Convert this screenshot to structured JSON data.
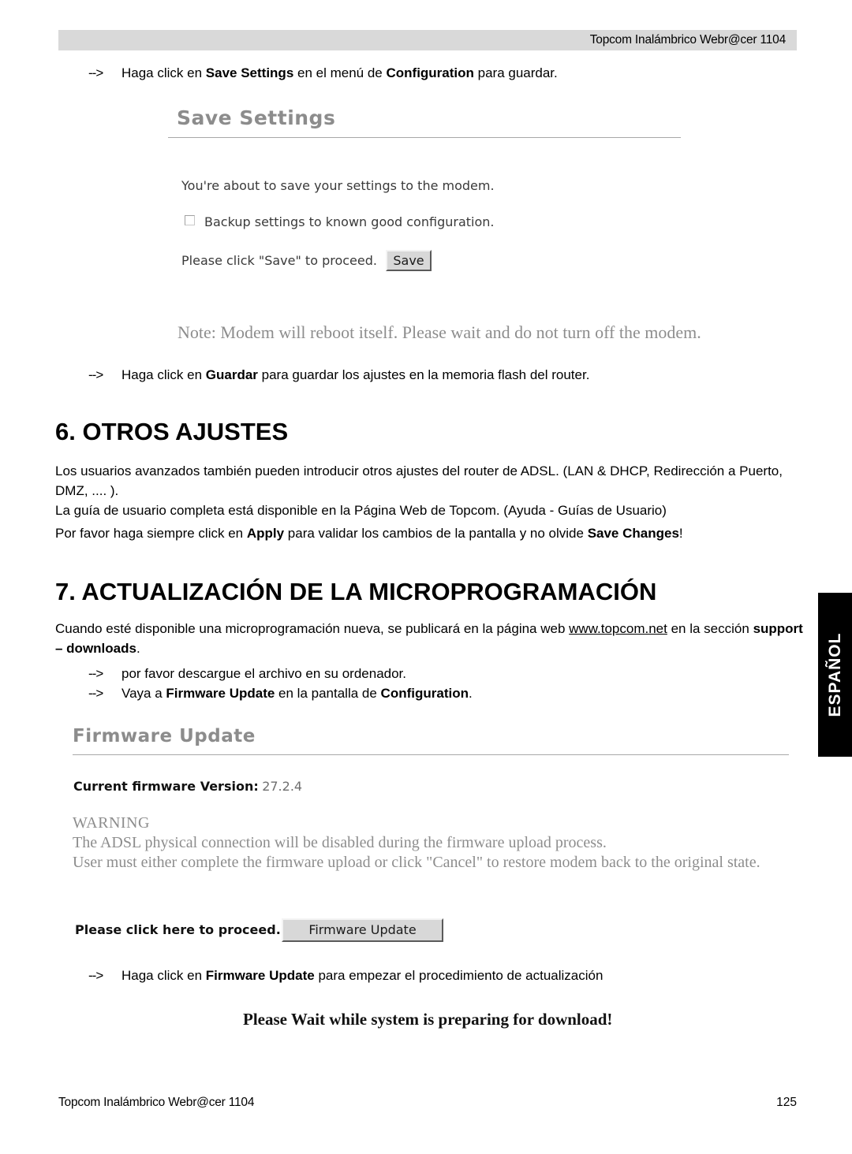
{
  "header": {
    "title": "Topcom Inalámbrico Webr@cer 1104"
  },
  "instructions": {
    "save_settings_intro_prefix": "Haga click en ",
    "save_settings_intro_bold1": "Save Settings",
    "save_settings_intro_mid": " en el menú de ",
    "save_settings_intro_bold2": "Configuration",
    "save_settings_intro_suffix": " para guardar.",
    "guardar_prefix": "Haga click en ",
    "guardar_bold": "Guardar",
    "guardar_suffix": " para guardar los ajustes en la memoria flash del router.",
    "download_file": "por favor descargue el archivo en su ordenador.",
    "goto_prefix": "Vaya a ",
    "goto_bold1": "Firmware Update",
    "goto_mid": " en la pantalla de ",
    "goto_bold2": "Configuration",
    "goto_suffix": ".",
    "firmware_click_prefix": "Haga click en ",
    "firmware_click_bold": "Firmware Update",
    "firmware_click_suffix": " para empezar el procedimiento de actualización",
    "arrow": "-->"
  },
  "save_settings_panel": {
    "title": "Save Settings",
    "about_to_save": "You're about to save your settings to the modem.",
    "backup_label": "Backup settings to known good configuration.",
    "please_click_label": "Please click \"Save\" to proceed.",
    "save_button": "Save",
    "note": "Note: Modem will reboot itself. Please wait and do not turn off the modem."
  },
  "section6": {
    "heading": "6. OTROS AJUSTES",
    "para1_line1": "Los usuarios avanzados también pueden introducir otros ajustes del router de ADSL. (LAN & DHCP, Redirección a",
    "para1_line2": "Puerto, DMZ, .... ).",
    "para1_line3": "La guía de usuario completa está disponible en la Página Web de Topcom. (Ayuda - Guías de Usuario)",
    "para2_prefix": "Por favor haga siempre  click en ",
    "para2_bold1": "Apply",
    "para2_mid": " para validar los cambios de la pantalla y no olvide ",
    "para2_bold2": "Save Changes",
    "para2_suffix": "!"
  },
  "section7": {
    "heading": "7. ACTUALIZACIÓN DE LA MICROPROGRAMACIÓN",
    "para_prefix": "Cuando esté disponible una microprogramación nueva, se publicará en la página web ",
    "para_link": "www.topcom.net",
    "para_mid": " en la sección",
    "para_bold": "support – downloads",
    "para_suffix": "."
  },
  "firmware_panel": {
    "title": "Firmware Update",
    "current_version_label": "Current firmware Version:",
    "current_version_value": "27.2.4",
    "warning_title": "WARNING",
    "warning_line1": "The ADSL physical connection will be disabled during the firmware upload process.",
    "warning_line2": "User must either complete the firmware upload or click \"Cancel\" to restore modem back to the original state.",
    "proceed_label": "Please click here to proceed.",
    "firmware_button": "Firmware Update",
    "please_wait": "Please Wait while system is preparing for download!"
  },
  "side_tab": {
    "label": "ESPAÑOL"
  },
  "footer": {
    "left": "Topcom Inalámbrico Webr@cer 1104",
    "page_number": "125"
  },
  "colors": {
    "header_bar": "#d9d9d9",
    "panel_title": "#8c8c8c",
    "warning_text": "#8d8d8d",
    "side_tab": "#000000",
    "button_face": "#d8d8d8"
  }
}
